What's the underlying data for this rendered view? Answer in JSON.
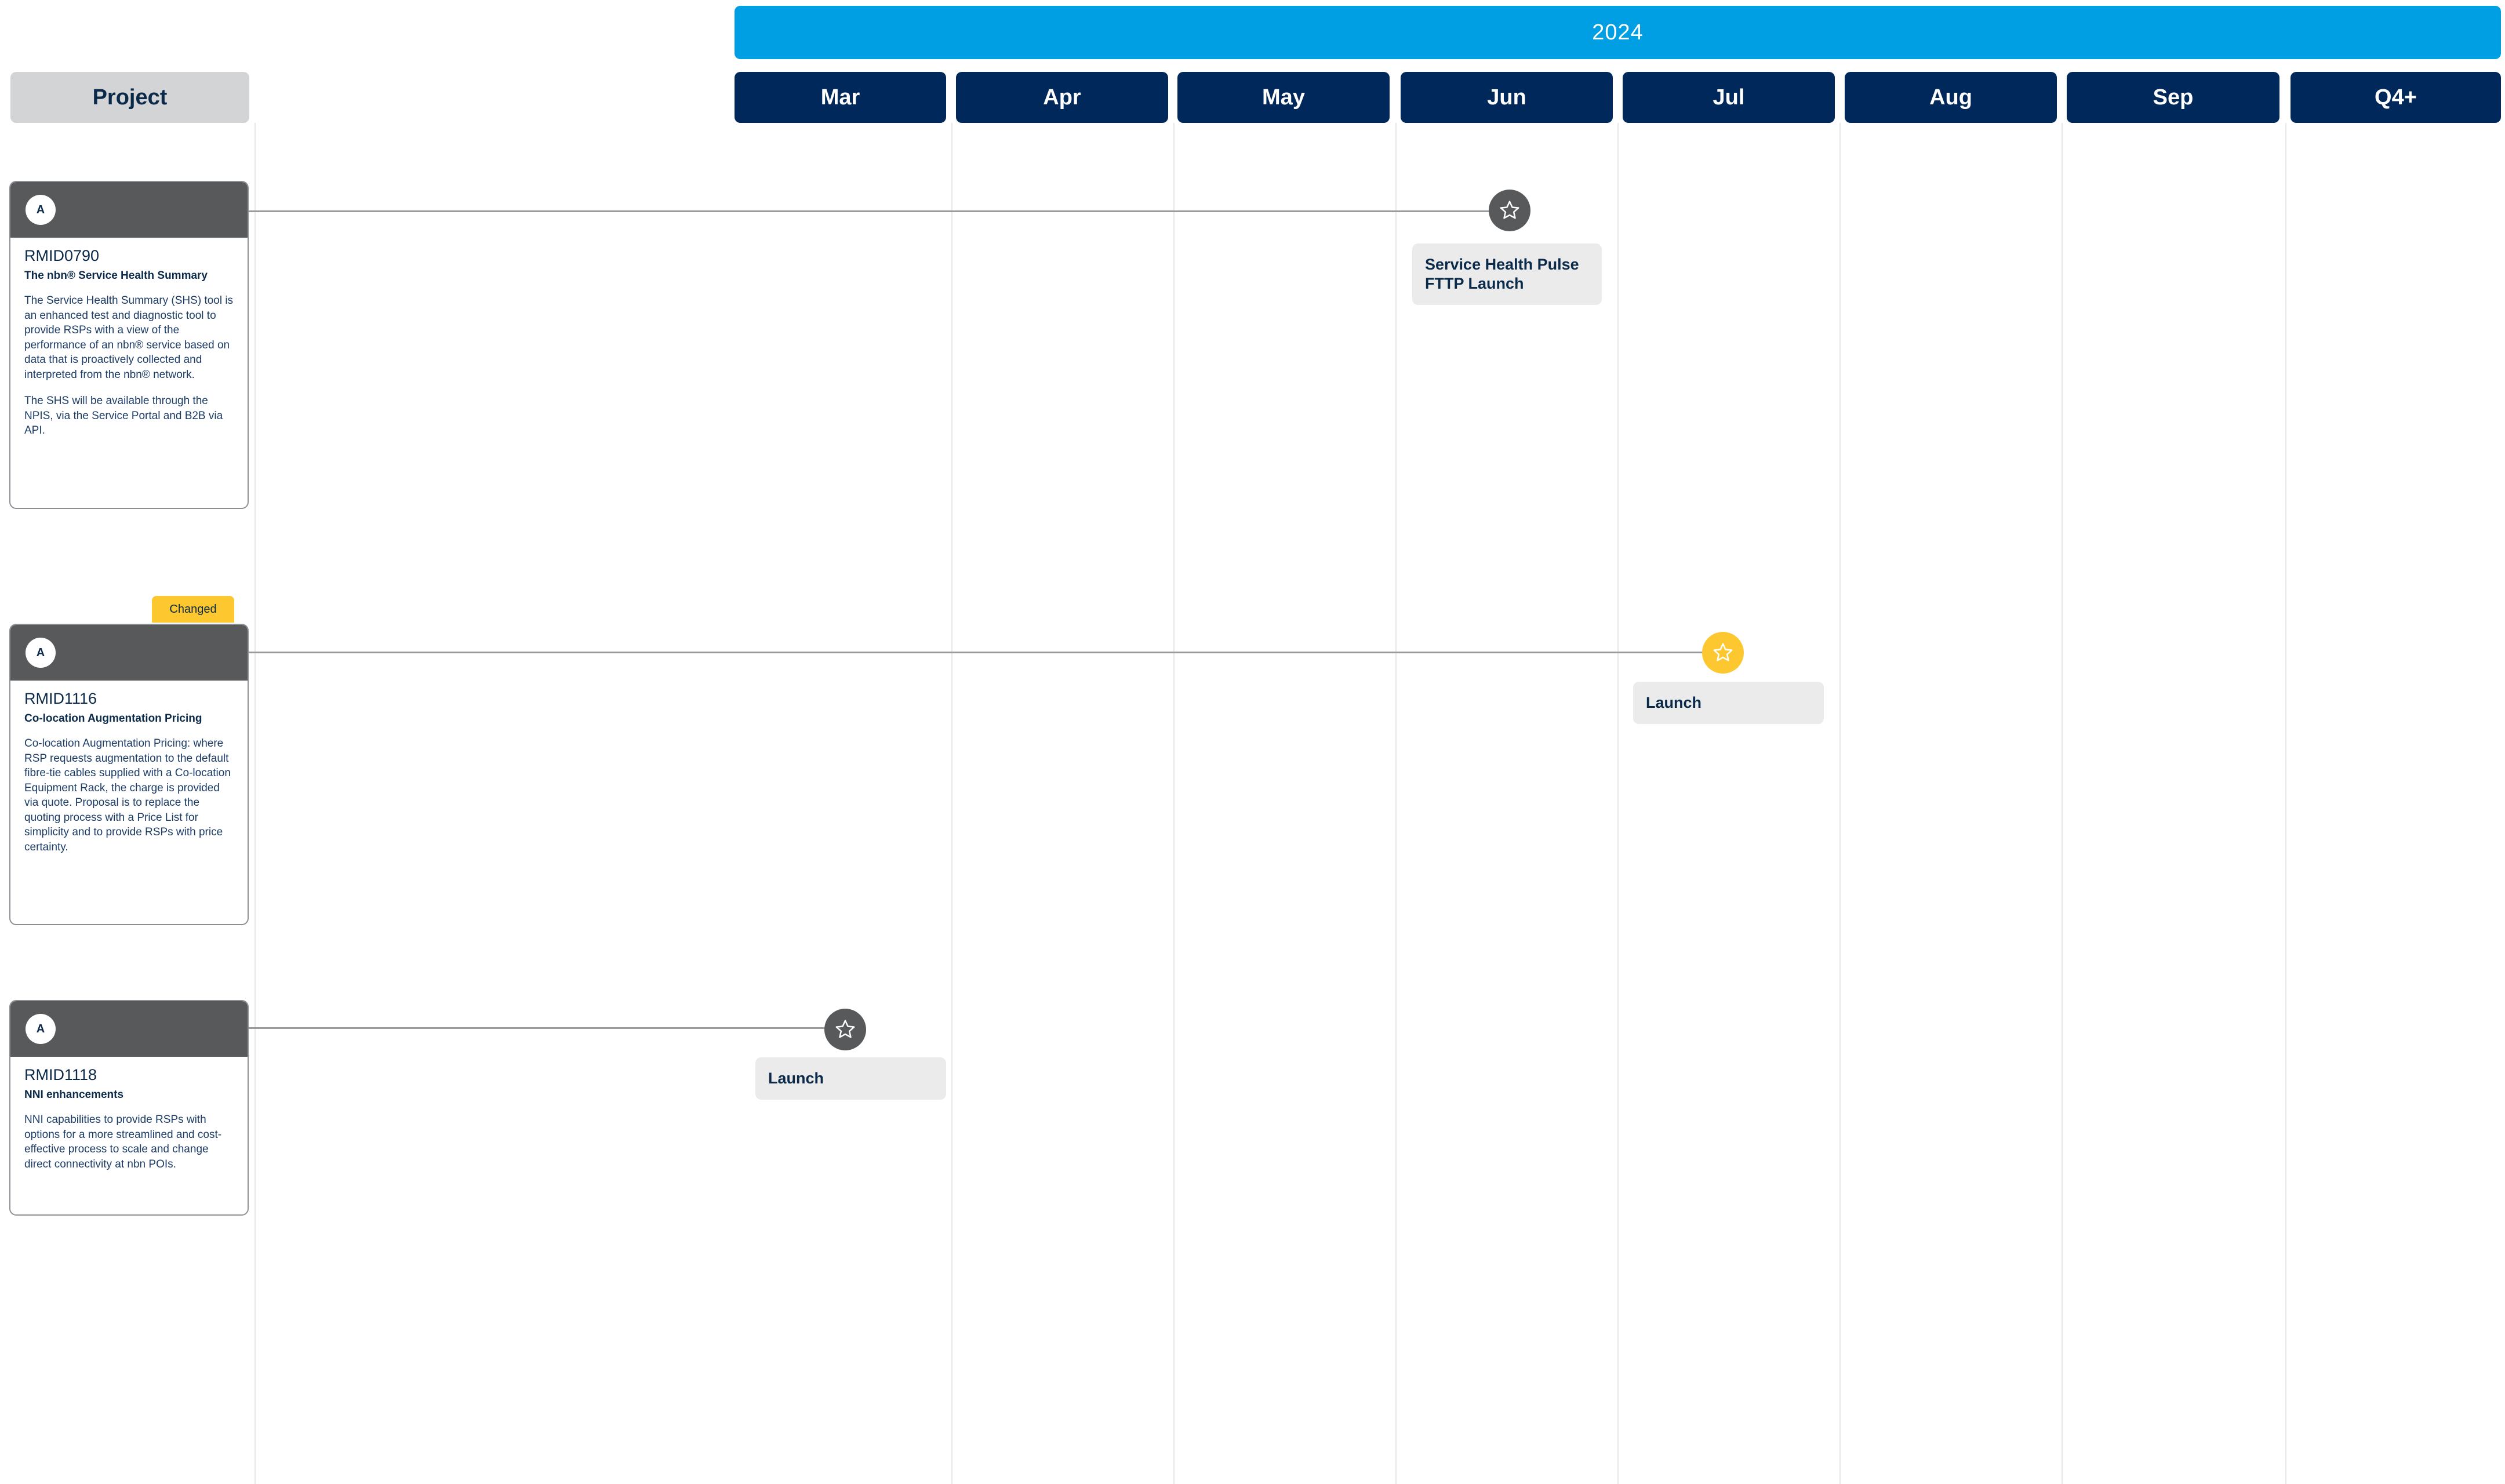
{
  "header": {
    "year": "2024",
    "project_label": "Project",
    "months": [
      "Mar",
      "Apr",
      "May",
      "Jun",
      "Jul",
      "Aug",
      "Sep",
      "Q4+"
    ]
  },
  "colors": {
    "year_bar": "#009fe3",
    "month_header": "#00285a",
    "card_header": "#58595b",
    "milestone_default": "#58595b",
    "milestone_changed": "#fdc82f",
    "changed_tag": "#fdc82f"
  },
  "projects": [
    {
      "badge": "A",
      "id": "RMID0790",
      "title": "The nbn® Service Health Summary",
      "description": [
        "The Service Health Summary (SHS) tool is an enhanced test and diagnostic tool to provide RSPs with a view of the performance of an nbn® service based on data that is proactively collected and interpreted from the nbn® network.",
        "The SHS will be available through the NPIS, via the Service Portal and B2B via API."
      ],
      "milestone": {
        "label": "Service Health Pulse FTTP Launch",
        "month": "Jun",
        "icon": "star-icon",
        "status": "default"
      }
    },
    {
      "badge": "A",
      "id": "RMID1116",
      "title": "Co-location Augmentation Pricing",
      "changed_tag": "Changed",
      "description": [
        "Co-location Augmentation Pricing: where RSP requests augmentation to the default fibre-tie cables supplied with a Co-location Equipment Rack, the charge is provided via quote. Proposal is to replace the quoting process with a Price List for simplicity and to provide RSPs with price certainty."
      ],
      "milestone": {
        "label": "Launch",
        "month": "Jul",
        "icon": "star-icon",
        "status": "changed"
      }
    },
    {
      "badge": "A",
      "id": "RMID1118",
      "title": "NNI enhancements",
      "description": [
        "NNI capabilities to provide RSPs with options for a more streamlined and cost-effective process to scale and change direct connectivity at nbn POIs."
      ],
      "milestone": {
        "label": "Launch",
        "month": "Mar",
        "icon": "star-icon",
        "status": "default"
      }
    }
  ]
}
